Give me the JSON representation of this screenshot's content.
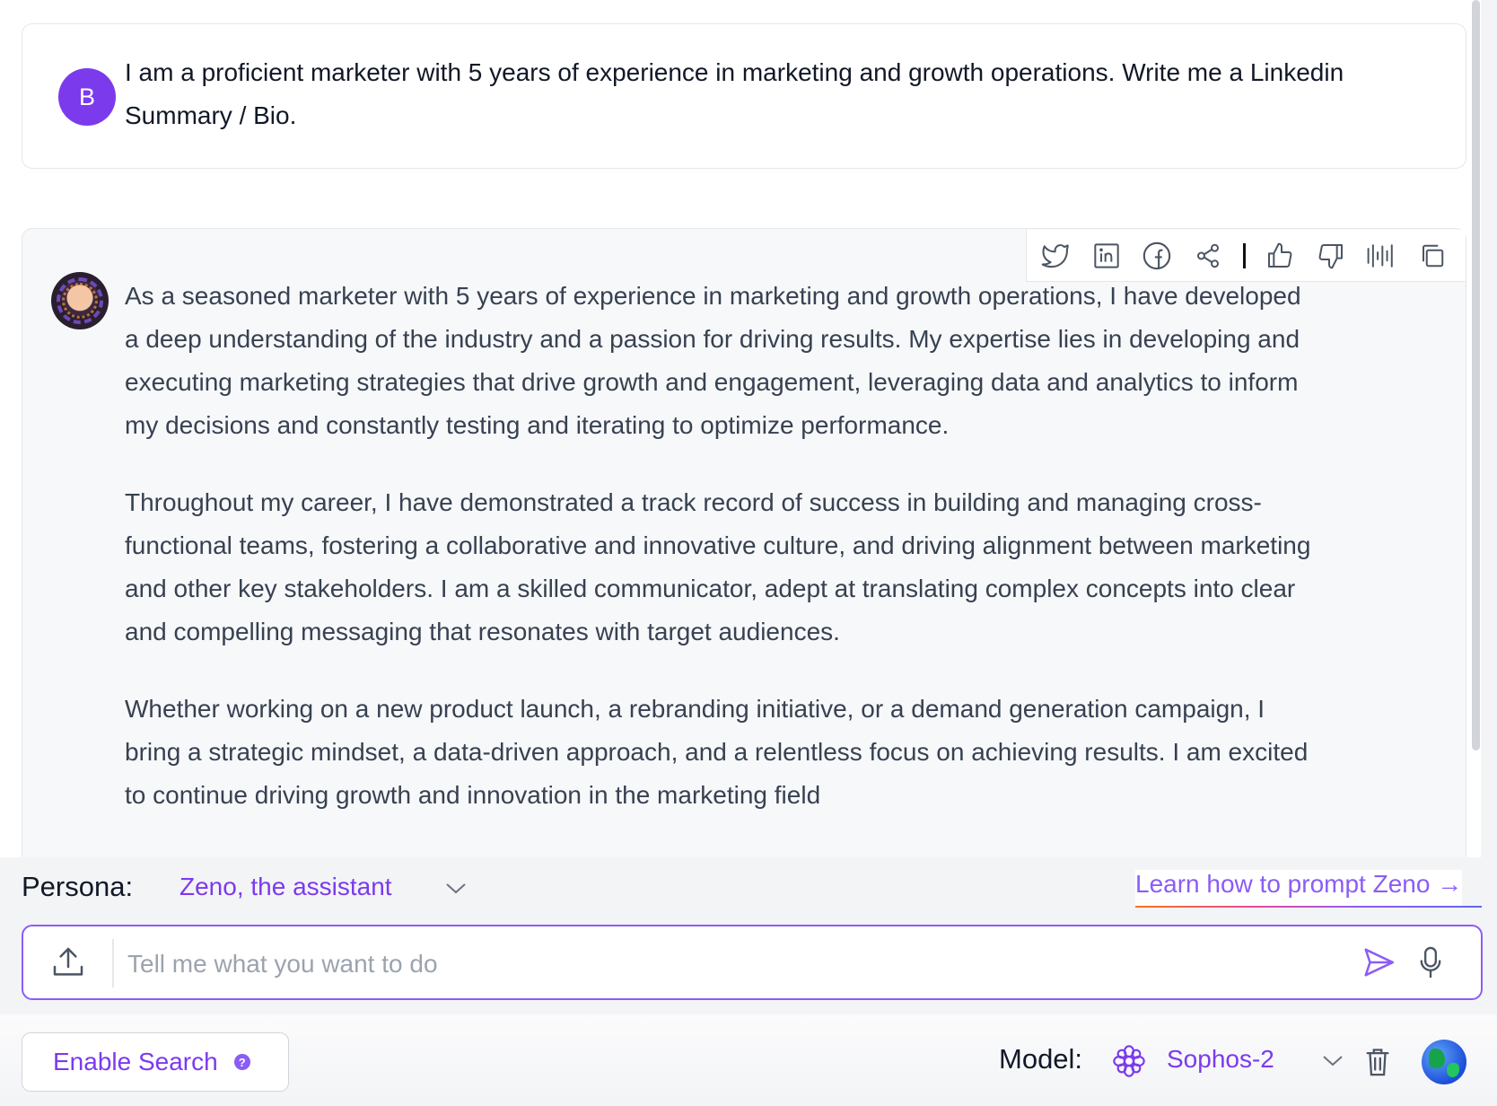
{
  "conversation": {
    "user": {
      "avatar_initial": "B",
      "message": "I am a proficient marketer with 5 years of experience in marketing and growth operations. Write me a Linkedin Summary / Bio."
    },
    "assistant": {
      "paragraphs": [
        "As a seasoned marketer with 5 years of experience in marketing and growth operations, I have developed a deep understanding of the industry and a passion for driving results. My expertise lies in developing and executing marketing strategies that drive growth and engagement, leveraging data and analytics to inform my decisions and constantly testing and iterating to optimize performance.",
        "Throughout my career, I have demonstrated a track record of success in building and managing cross-functional teams, fostering a collaborative and innovative culture, and driving alignment between marketing and other key stakeholders. I am a skilled communicator, adept at translating complex concepts into clear and compelling messaging that resonates with target audiences.",
        "Whether working on a new product launch, a rebranding initiative, or a demand generation campaign, I bring a strategic mindset, a data-driven approach, and a relentless focus on achieving results. I am excited to continue driving growth and innovation in the marketing field"
      ],
      "toolbar_icons": [
        "twitter-icon",
        "linkedin-icon",
        "facebook-icon",
        "share-icon",
        "thumbs-up-icon",
        "thumbs-down-icon",
        "audio-waveform-icon",
        "copy-icon"
      ]
    }
  },
  "persona": {
    "label": "Persona:",
    "value": "Zeno, the assistant"
  },
  "learn_link": "Learn how to prompt Zeno →",
  "input": {
    "placeholder": "Tell me what you want to do",
    "value": ""
  },
  "enable_search": {
    "label": "Enable Search",
    "help": "?"
  },
  "model": {
    "label": "Model:",
    "value": "Sophos-2"
  },
  "colors": {
    "accent": "#7c3aed",
    "user_avatar": "#7c3aed",
    "bot_bubble": "#f7f8fa"
  }
}
